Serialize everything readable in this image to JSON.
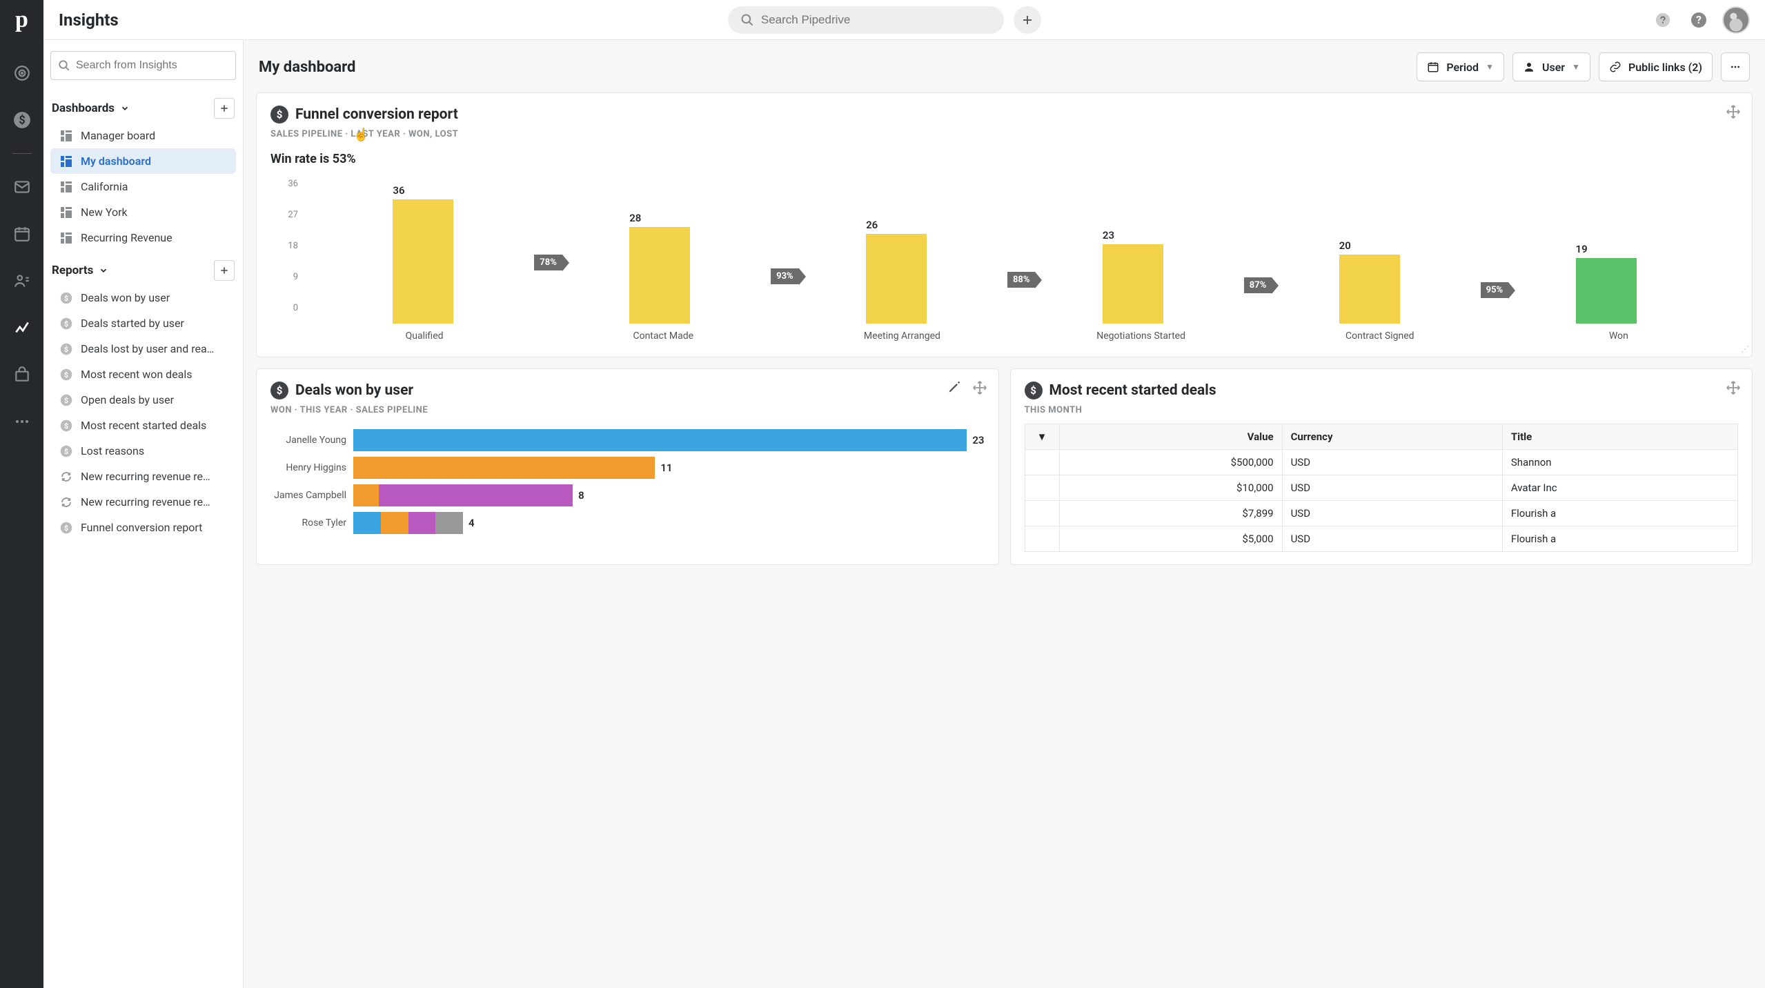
{
  "app_name": "Insights",
  "global_search_placeholder": "Search Pipedrive",
  "sidebar": {
    "search_placeholder": "Search from Insights",
    "dashboards_label": "Dashboards",
    "reports_label": "Reports",
    "dashboards": [
      {
        "label": "Manager board"
      },
      {
        "label": "My dashboard"
      },
      {
        "label": "California"
      },
      {
        "label": "New York"
      },
      {
        "label": "Recurring Revenue"
      }
    ],
    "reports": [
      {
        "label": "Deals won by user",
        "icon": "dollar"
      },
      {
        "label": "Deals started by user",
        "icon": "dollar"
      },
      {
        "label": "Deals lost by user and rea…",
        "icon": "dollar"
      },
      {
        "label": "Most recent won deals",
        "icon": "dollar"
      },
      {
        "label": "Open deals by user",
        "icon": "dollar"
      },
      {
        "label": "Most recent started deals",
        "icon": "dollar"
      },
      {
        "label": "Lost reasons",
        "icon": "dollar"
      },
      {
        "label": "New recurring revenue re…",
        "icon": "cycle"
      },
      {
        "label": "New recurring revenue re…",
        "icon": "cycle"
      },
      {
        "label": "Funnel conversion report",
        "icon": "dollar"
      }
    ]
  },
  "header": {
    "title": "My dashboard",
    "period_label": "Period",
    "user_label": "User",
    "public_links_label": "Public links (2)"
  },
  "funnel": {
    "title": "Funnel conversion report",
    "subtitle": "SALES PIPELINE  ·  LAST YEAR  ·  WON, LOST",
    "win_rate": "Win rate is 53%"
  },
  "deals_won": {
    "title": "Deals won by user",
    "subtitle": "WON  ·  THIS YEAR  ·  SALES PIPELINE"
  },
  "recent_deals": {
    "title": "Most recent started deals",
    "subtitle": "THIS MONTH",
    "columns": {
      "value": "Value",
      "currency": "Currency",
      "title": "Title"
    },
    "rows": [
      {
        "value": "$500,000",
        "currency": "USD",
        "title": "Shannon"
      },
      {
        "value": "$10,000",
        "currency": "USD",
        "title": "Avatar Inc"
      },
      {
        "value": "$7,899",
        "currency": "USD",
        "title": "Flourish a"
      },
      {
        "value": "$5,000",
        "currency": "USD",
        "title": "Flourish a"
      }
    ]
  },
  "chart_data": [
    {
      "id": "funnel",
      "type": "bar",
      "title": "Funnel conversion report",
      "ylabel": "",
      "ylim": [
        0,
        36
      ],
      "y_ticks": [
        36,
        27,
        18,
        9,
        0
      ],
      "categories": [
        "Qualified",
        "Contact Made",
        "Meeting Arranged",
        "Negotiations Started",
        "Contract Signed",
        "Won"
      ],
      "values": [
        36,
        28,
        26,
        23,
        20,
        19
      ],
      "conversion": [
        "78%",
        "93%",
        "88%",
        "87%",
        "95%"
      ],
      "colors": [
        "#f2d24a",
        "#f2d24a",
        "#f2d24a",
        "#f2d24a",
        "#f2d24a",
        "#5cc26a"
      ]
    },
    {
      "id": "deals_won_by_user",
      "type": "bar",
      "orientation": "horizontal",
      "categories": [
        "Janelle Young",
        "Henry Higgins",
        "James Campbell",
        "Rose Tyler"
      ],
      "values": [
        23,
        11,
        8,
        4
      ],
      "colors": [
        "#3aa5e0",
        "#f29b2e",
        "#b85ac0",
        "#999999"
      ],
      "stacked_last": true,
      "xmax": 23
    }
  ]
}
